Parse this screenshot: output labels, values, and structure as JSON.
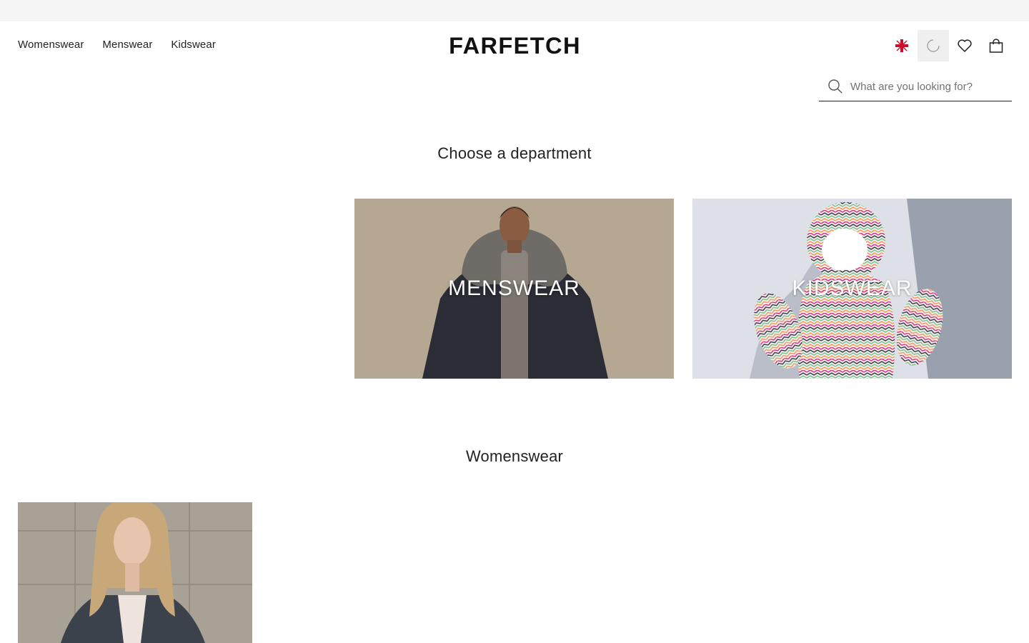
{
  "header": {
    "nav": [
      "Womenswear",
      "Menswear",
      "Kidswear"
    ],
    "logo": "FARFETCH",
    "icons": [
      "union-jack-flag-icon",
      "loading-spinner-icon",
      "heart-icon",
      "shopping-bag-icon"
    ]
  },
  "search": {
    "placeholder": "What are you looking for?",
    "value": ""
  },
  "main": {
    "department_title": "Choose a department",
    "departments": [
      {
        "label": "MENSWEAR"
      },
      {
        "label": "KIDSWEAR"
      }
    ],
    "womenswear_title": "Womenswear"
  },
  "colors": {
    "text": "#222222",
    "top_strip": "#f5f5f5",
    "active_icon_bg": "#efefef",
    "flag_red": "#c8102e"
  }
}
